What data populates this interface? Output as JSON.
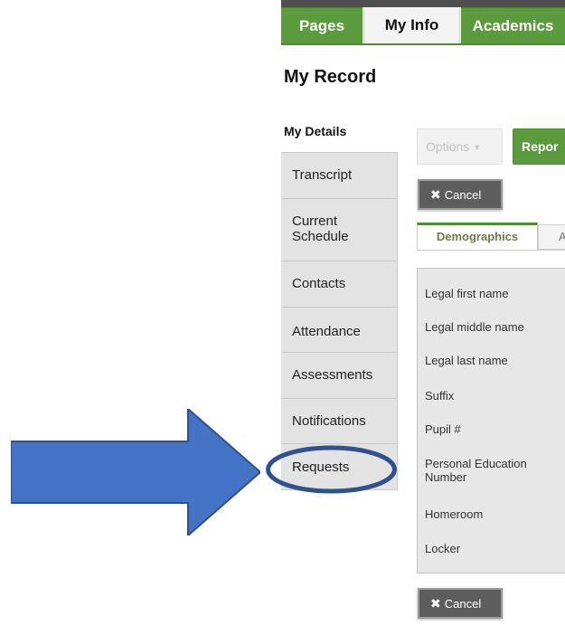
{
  "nav": {
    "tabs": [
      {
        "label": "Pages"
      },
      {
        "label": "My Info"
      },
      {
        "label": "Academics"
      }
    ]
  },
  "page": {
    "title": "My Record"
  },
  "sidebar": {
    "heading": "My Details",
    "items": [
      {
        "label": "Transcript"
      },
      {
        "label": "Current Schedule"
      },
      {
        "label": "Contacts"
      },
      {
        "label": "Attendance"
      },
      {
        "label": "Assessments"
      },
      {
        "label": "Notifications"
      },
      {
        "label": "Requests"
      }
    ]
  },
  "toolbar": {
    "options_label": "Options",
    "report_label": "Repor",
    "cancel_label": "Cancel",
    "cancel_bottom_label": "Cancel"
  },
  "subtabs": {
    "active": "Demographics",
    "next": "A"
  },
  "fields": [
    {
      "label": "Legal first name"
    },
    {
      "label": "Legal middle name"
    },
    {
      "label": "Legal last name"
    },
    {
      "label": "Suffix"
    },
    {
      "label": "Pupil #"
    },
    {
      "label": "Personal Education Number"
    },
    {
      "label": "Homeroom"
    },
    {
      "label": "Locker"
    }
  ],
  "colors": {
    "accent_green": "#5b9a3d",
    "annotation_blue": "#4472c4",
    "annotation_outline": "#2f528f"
  },
  "icons": [
    "close-icon",
    "caret-down-icon",
    "arrow-annotation"
  ]
}
